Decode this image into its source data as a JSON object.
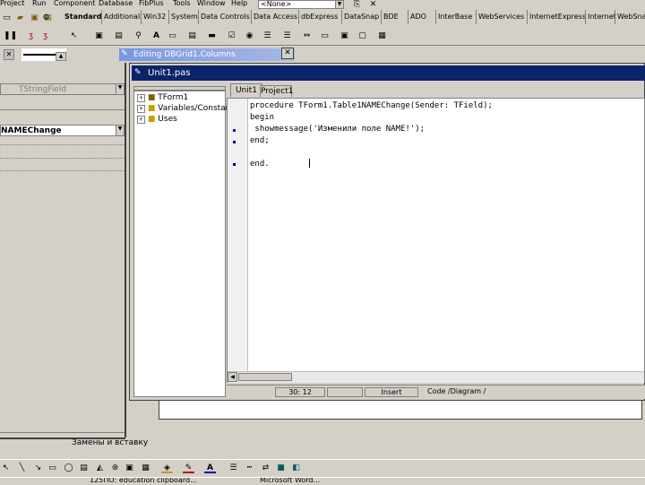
{
  "menu": [
    "Project",
    "Run",
    "Component",
    "Database",
    "FibPlus",
    "Tools",
    "Window",
    "Help"
  ],
  "config_combo": "<None>",
  "palette_tabs": [
    "Standard",
    "Additional",
    "Win32",
    "System",
    "Data Controls",
    "Data Access",
    "dbExpress",
    "DataSnap",
    "BDE",
    "ADO",
    "InterBase",
    "WebServices",
    "InternetExpress",
    "Internet",
    "WebSnap"
  ],
  "object_inspector": {
    "object_combo": "TStringField",
    "event_value": "NAMEChange"
  },
  "dbgrid_editor": {
    "title": "Editing DBGrid1.Columns"
  },
  "editor": {
    "title": "Unit1.pas",
    "tabs": [
      "Unit1",
      "Project1"
    ],
    "tree": [
      "TForm1",
      "Variables/Constants",
      "Uses"
    ],
    "code_lines": [
      "procedure TForm1.Table1NAMEChange(Sender: TField);",
      "begin",
      " showmessage('Изменили поле NAME!');",
      "end;",
      "",
      "end."
    ],
    "status": {
      "position": "30: 12",
      "mode": "Insert",
      "view_tabs": "Code /Diagram /"
    }
  },
  "message_bar": "Замены и вставку",
  "taskbar_items": [
    "125ПО: education clipboard...",
    "Microsoft Word..."
  ]
}
